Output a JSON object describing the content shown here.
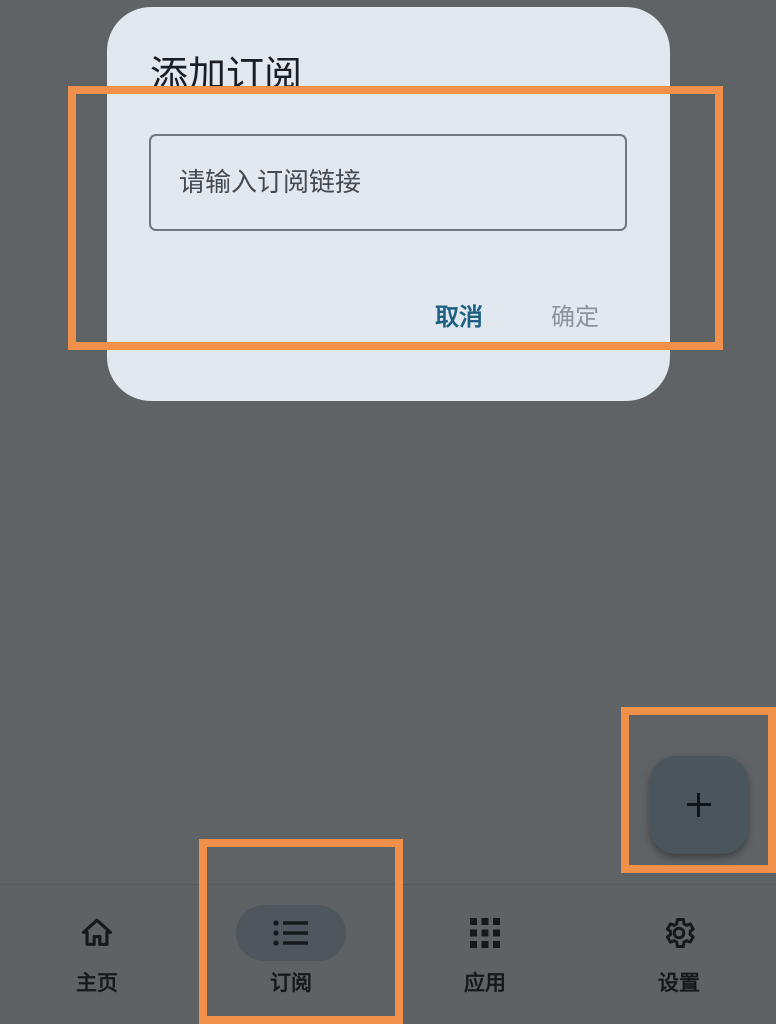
{
  "dialog": {
    "title": "添加订阅",
    "input_placeholder": "请输入订阅链接",
    "input_value": "",
    "cancel_label": "取消",
    "confirm_label": "确定"
  },
  "fab": {
    "icon": "plus-icon"
  },
  "nav": {
    "items": [
      {
        "label": "主页",
        "icon": "home-icon",
        "active": false
      },
      {
        "label": "订阅",
        "icon": "list-icon",
        "active": true
      },
      {
        "label": "应用",
        "icon": "grid-icon",
        "active": false
      },
      {
        "label": "设置",
        "icon": "gear-icon",
        "active": false
      }
    ]
  },
  "colors": {
    "scrim": "#606366",
    "dialog_bg": "#e1e8ef",
    "accent": "#1e6283",
    "highlight": "#f0904a",
    "fab_bg": "#4b555d"
  }
}
